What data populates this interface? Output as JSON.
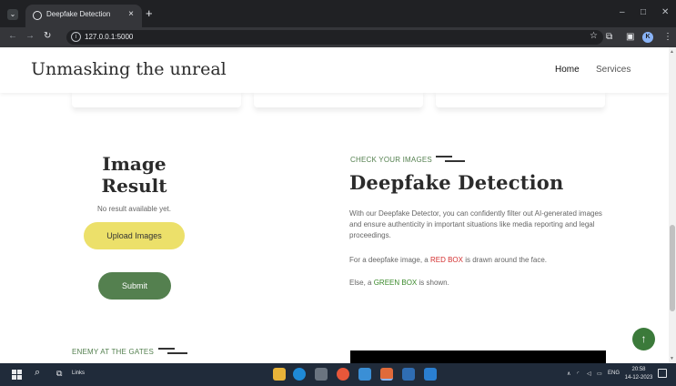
{
  "browser": {
    "tab_title": "Deepfake Detection",
    "tab_close": "×",
    "new_tab": "+",
    "url": "127.0.0.1:5000",
    "window_minimize": "–",
    "window_maximize": "□",
    "window_close": "✕",
    "profile_initial": "K"
  },
  "site": {
    "brand": "Unmasking the unreal",
    "nav": {
      "home": "Home",
      "services": "Services"
    }
  },
  "result_panel": {
    "title_line1": "Image",
    "title_line2": "Result",
    "status": "No result available yet.",
    "upload_label": "Upload Images",
    "submit_label": "Submit"
  },
  "info_panel": {
    "eyebrow": "CHECK YOUR IMAGES",
    "heading": "Deepfake Detection",
    "paragraph1": "With our Deepfake Detector, you can confidently filter out AI-generated images and ensure authenticity in important situations like media reporting and legal proceedings.",
    "paragraph2_before": "For a deepfake image, a ",
    "paragraph2_highlight": "RED BOX",
    "paragraph2_after": " is drawn around the face.",
    "paragraph3_before": "Else, a ",
    "paragraph3_highlight": "GREEN BOX",
    "paragraph3_after": " is shown."
  },
  "lower_section": {
    "eyebrow": "ENEMY AT THE GATES"
  },
  "back_to_top": "↑",
  "taskbar": {
    "links_label": "Links",
    "lang": "ENG",
    "time": "20:58",
    "date": "14-12-2023"
  },
  "colors": {
    "accent_green": "#54804f",
    "upload_yellow": "#ece06a",
    "red_text": "#d32f2f",
    "green_text": "#3b8a2b"
  }
}
